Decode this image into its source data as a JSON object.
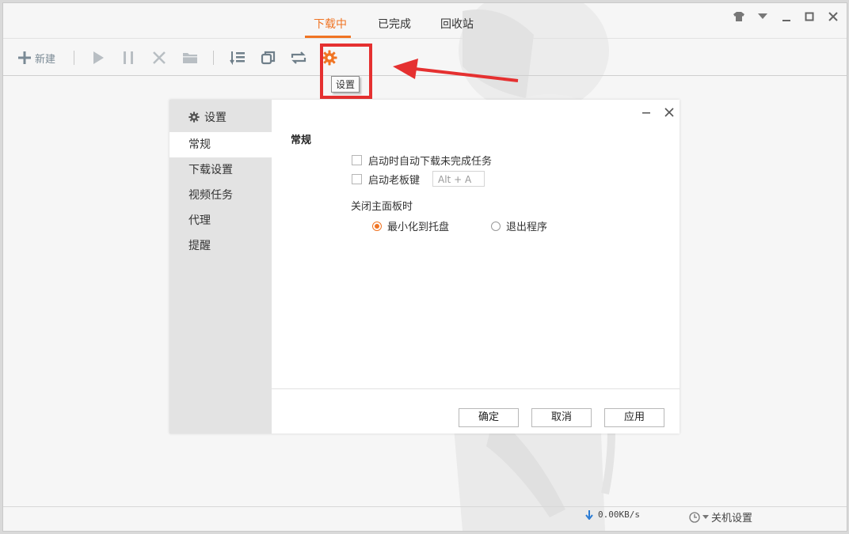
{
  "tabs": [
    {
      "label": "下载中",
      "active": true
    },
    {
      "label": "已完成",
      "active": false
    },
    {
      "label": "回收站",
      "active": false
    }
  ],
  "window_controls": [
    "skin-icon",
    "menu-icon",
    "minimize-icon",
    "maximize-icon",
    "close-icon"
  ],
  "toolbar": {
    "new_label": "新建",
    "buttons": [
      "play-icon",
      "pause-icon",
      "delete-icon",
      "folder-icon",
      "list-icon",
      "copy-icon",
      "refresh-icon",
      "settings-gear-icon"
    ],
    "tooltip": "设置"
  },
  "dialog": {
    "title": "设置",
    "nav": [
      {
        "label": "常规",
        "active": true
      },
      {
        "label": "下载设置",
        "active": false
      },
      {
        "label": "视频任务",
        "active": false
      },
      {
        "label": "代理",
        "active": false
      },
      {
        "label": "提醒",
        "active": false
      }
    ],
    "section_title": "常规",
    "options": {
      "auto_download_label": "启动时自动下载未完成任务",
      "boss_key_label": "启动老板键",
      "boss_key_value": "Alt + A",
      "close_panel_label": "关闭主面板时",
      "radio_minimize": "最小化到托盘",
      "radio_exit": "退出程序"
    },
    "buttons": {
      "ok": "确定",
      "cancel": "取消",
      "apply": "应用"
    }
  },
  "status": {
    "speed": "0.00KB/s",
    "shutdown_label": "关机设置"
  },
  "colors": {
    "accent": "#f07423",
    "highlight": "#e53030"
  }
}
